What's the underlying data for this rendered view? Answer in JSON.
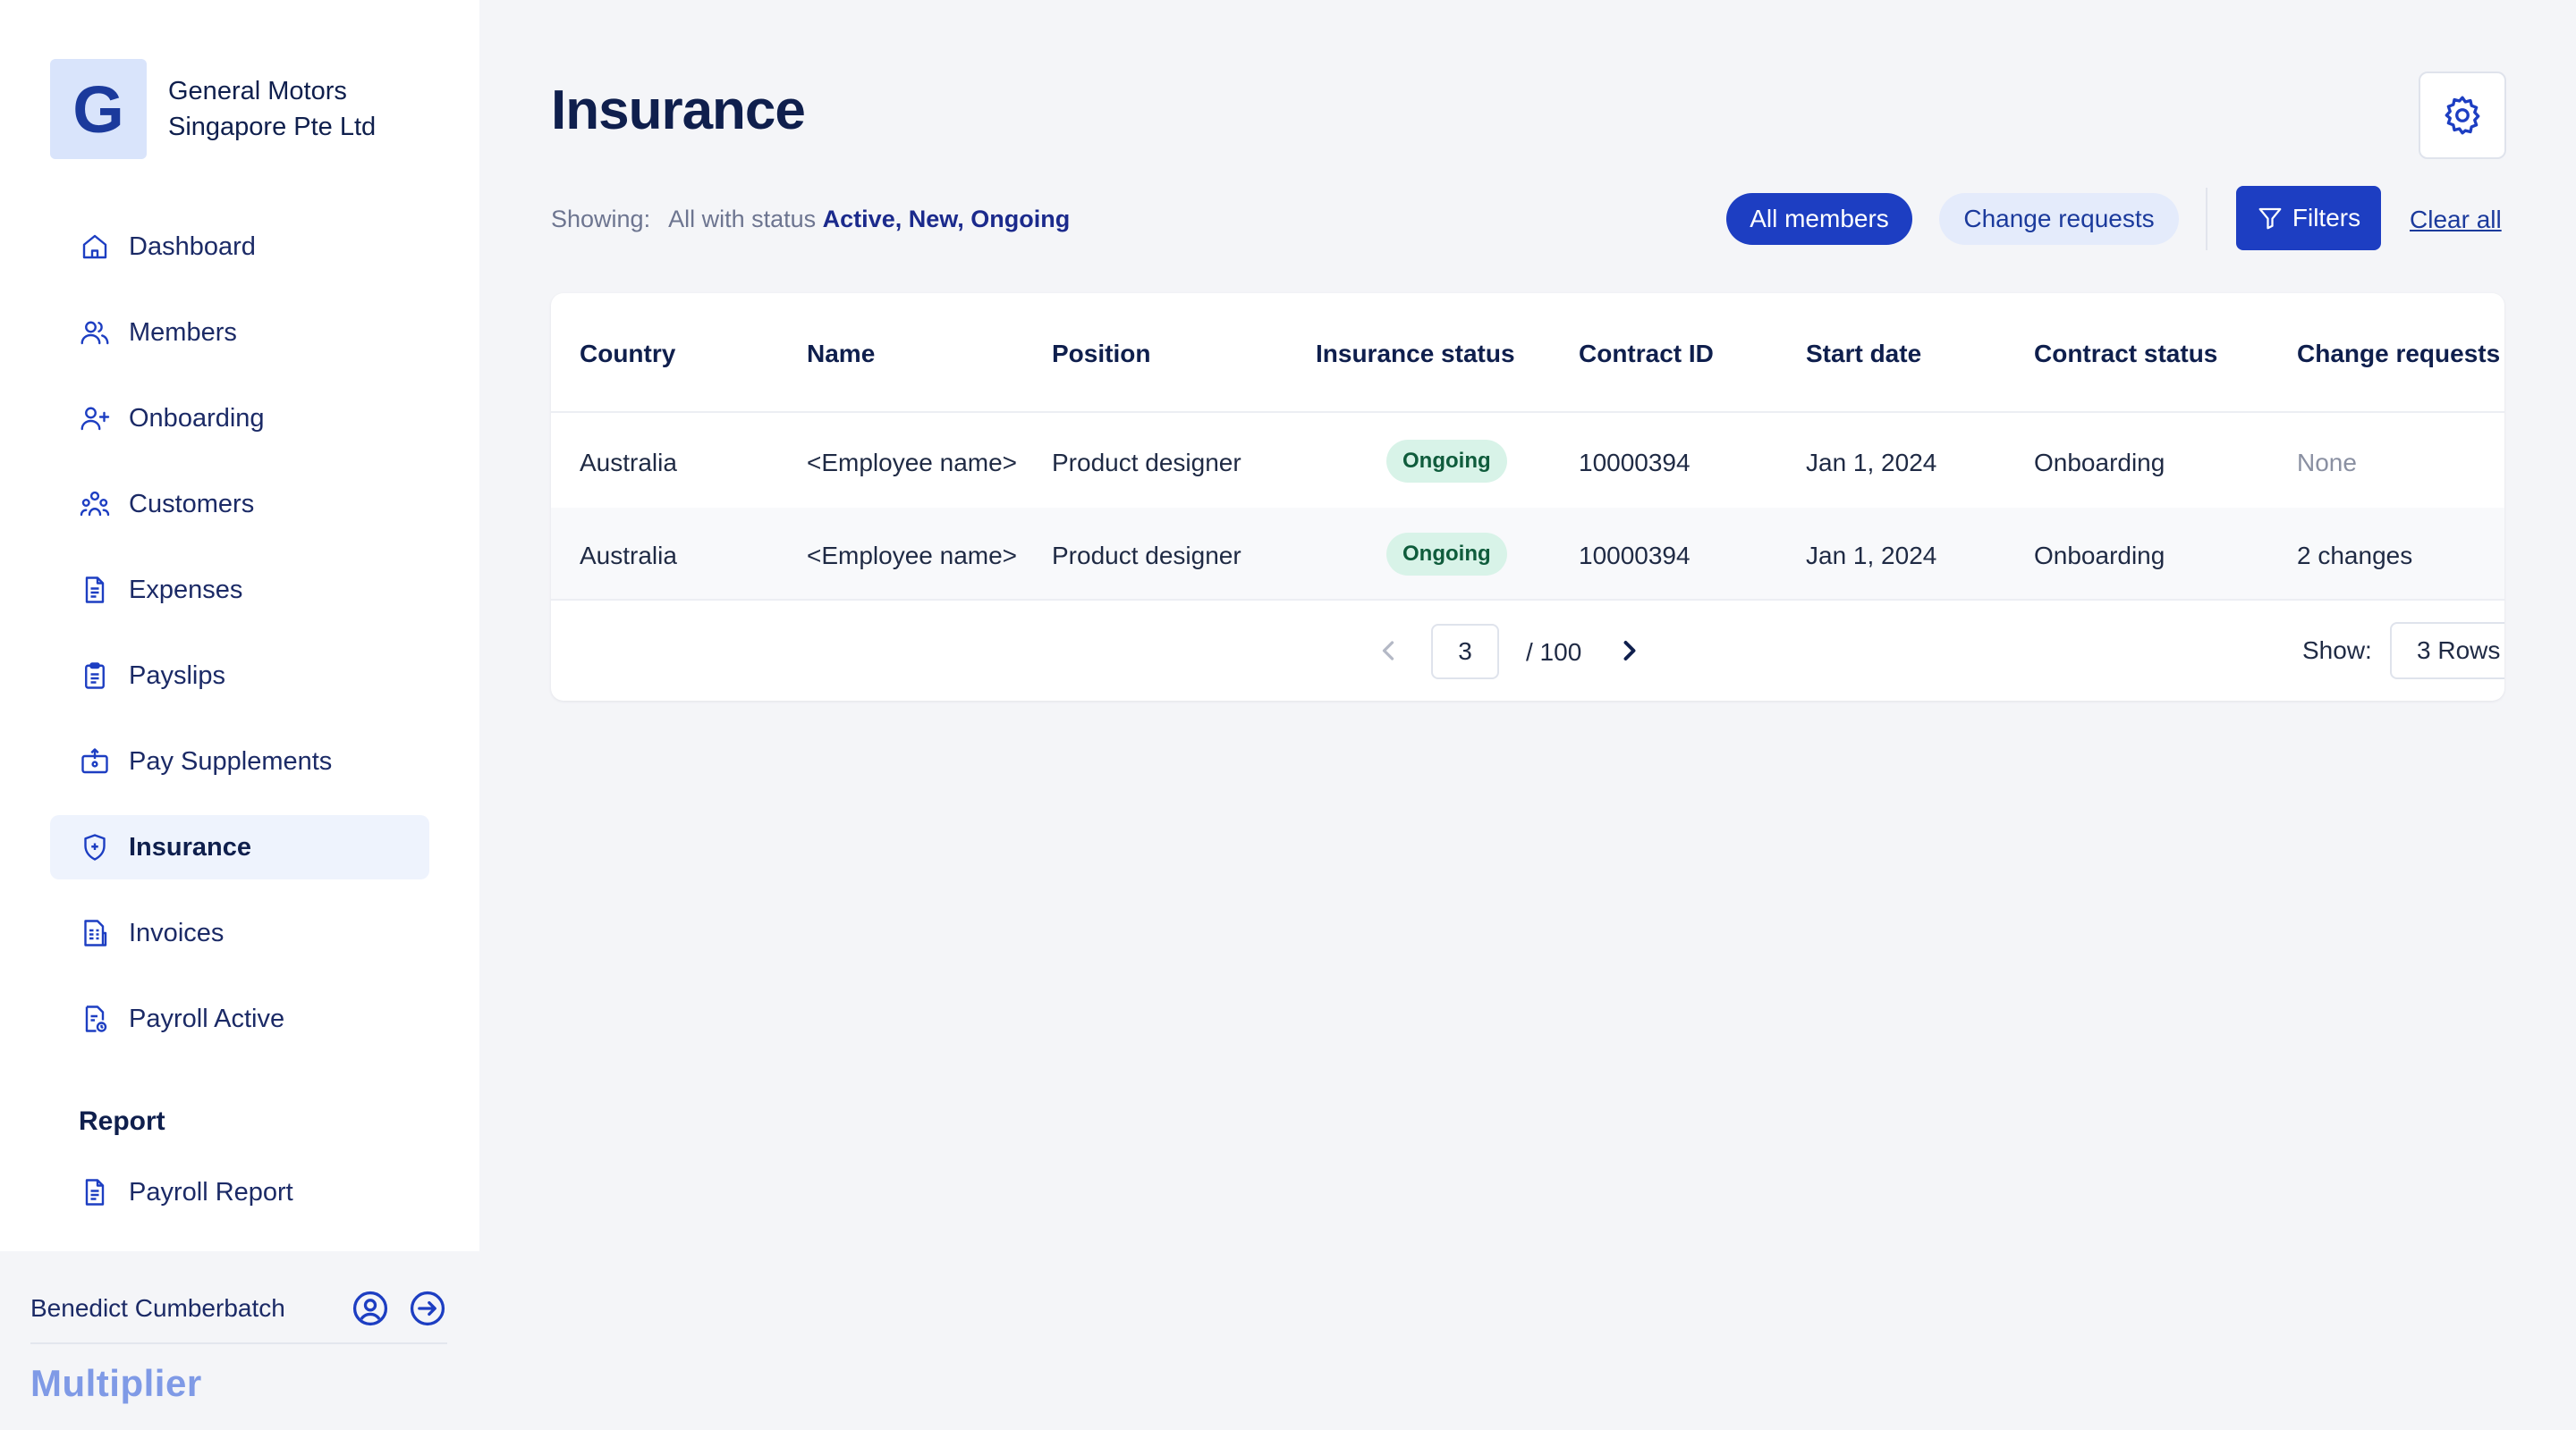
{
  "org": {
    "initial": "G",
    "name": "General Motors Singapore Pte Ltd"
  },
  "sidebar": {
    "items": [
      {
        "label": "Dashboard",
        "icon": "home-icon"
      },
      {
        "label": "Members",
        "icon": "users-icon"
      },
      {
        "label": "Onboarding",
        "icon": "user-plus-icon"
      },
      {
        "label": "Customers",
        "icon": "customers-icon"
      },
      {
        "label": "Expenses",
        "icon": "document-icon"
      },
      {
        "label": "Payslips",
        "icon": "clipboard-icon"
      },
      {
        "label": "Pay Supplements",
        "icon": "briefcase-icon"
      },
      {
        "label": "Insurance",
        "icon": "shield-icon",
        "active": true
      },
      {
        "label": "Invoices",
        "icon": "invoice-icon"
      },
      {
        "label": "Payroll Active",
        "icon": "payroll-icon"
      }
    ],
    "section_title": "Report",
    "report_items": [
      {
        "label": "Payroll Report",
        "icon": "report-icon"
      }
    ]
  },
  "footer": {
    "user_name": "Benedict Cumberbatch",
    "brand": "Multiplier"
  },
  "header": {
    "title": "Insurance",
    "showing_label": "Showing:",
    "showing_prefix": "All with status",
    "showing_status": "Active, New, Ongoing",
    "all_members": "All members",
    "change_requests": "Change requests",
    "filters": "Filters",
    "clear_all": "Clear all"
  },
  "table": {
    "columns": [
      "Country",
      "Name",
      "Position",
      "Insurance status",
      "Contract ID",
      "Start date",
      "Contract status",
      "Change requests"
    ],
    "rows": [
      {
        "country": "Australia",
        "name": "<Employee name>",
        "position": "Product designer",
        "insurance_status": "Ongoing",
        "contract_id": "10000394",
        "start_date": "Jan 1, 2024",
        "contract_status": "Onboarding",
        "change_requests": "None"
      },
      {
        "country": "Australia",
        "name": "<Employee name>",
        "position": "Product designer",
        "insurance_status": "Ongoing",
        "contract_id": "10000394",
        "start_date": "Jan 1, 2024",
        "contract_status": "Onboarding",
        "change_requests": "2 changes"
      }
    ]
  },
  "pagination": {
    "current_page": "3",
    "total": "/  100",
    "show_label": "Show:",
    "rows_option": "3 Rows"
  },
  "colors": {
    "primary": "#1d3ec2",
    "sidebar_active": "#eef3fd",
    "badge_bg": "#d8f3e8",
    "badge_text": "#0f5c3c"
  }
}
